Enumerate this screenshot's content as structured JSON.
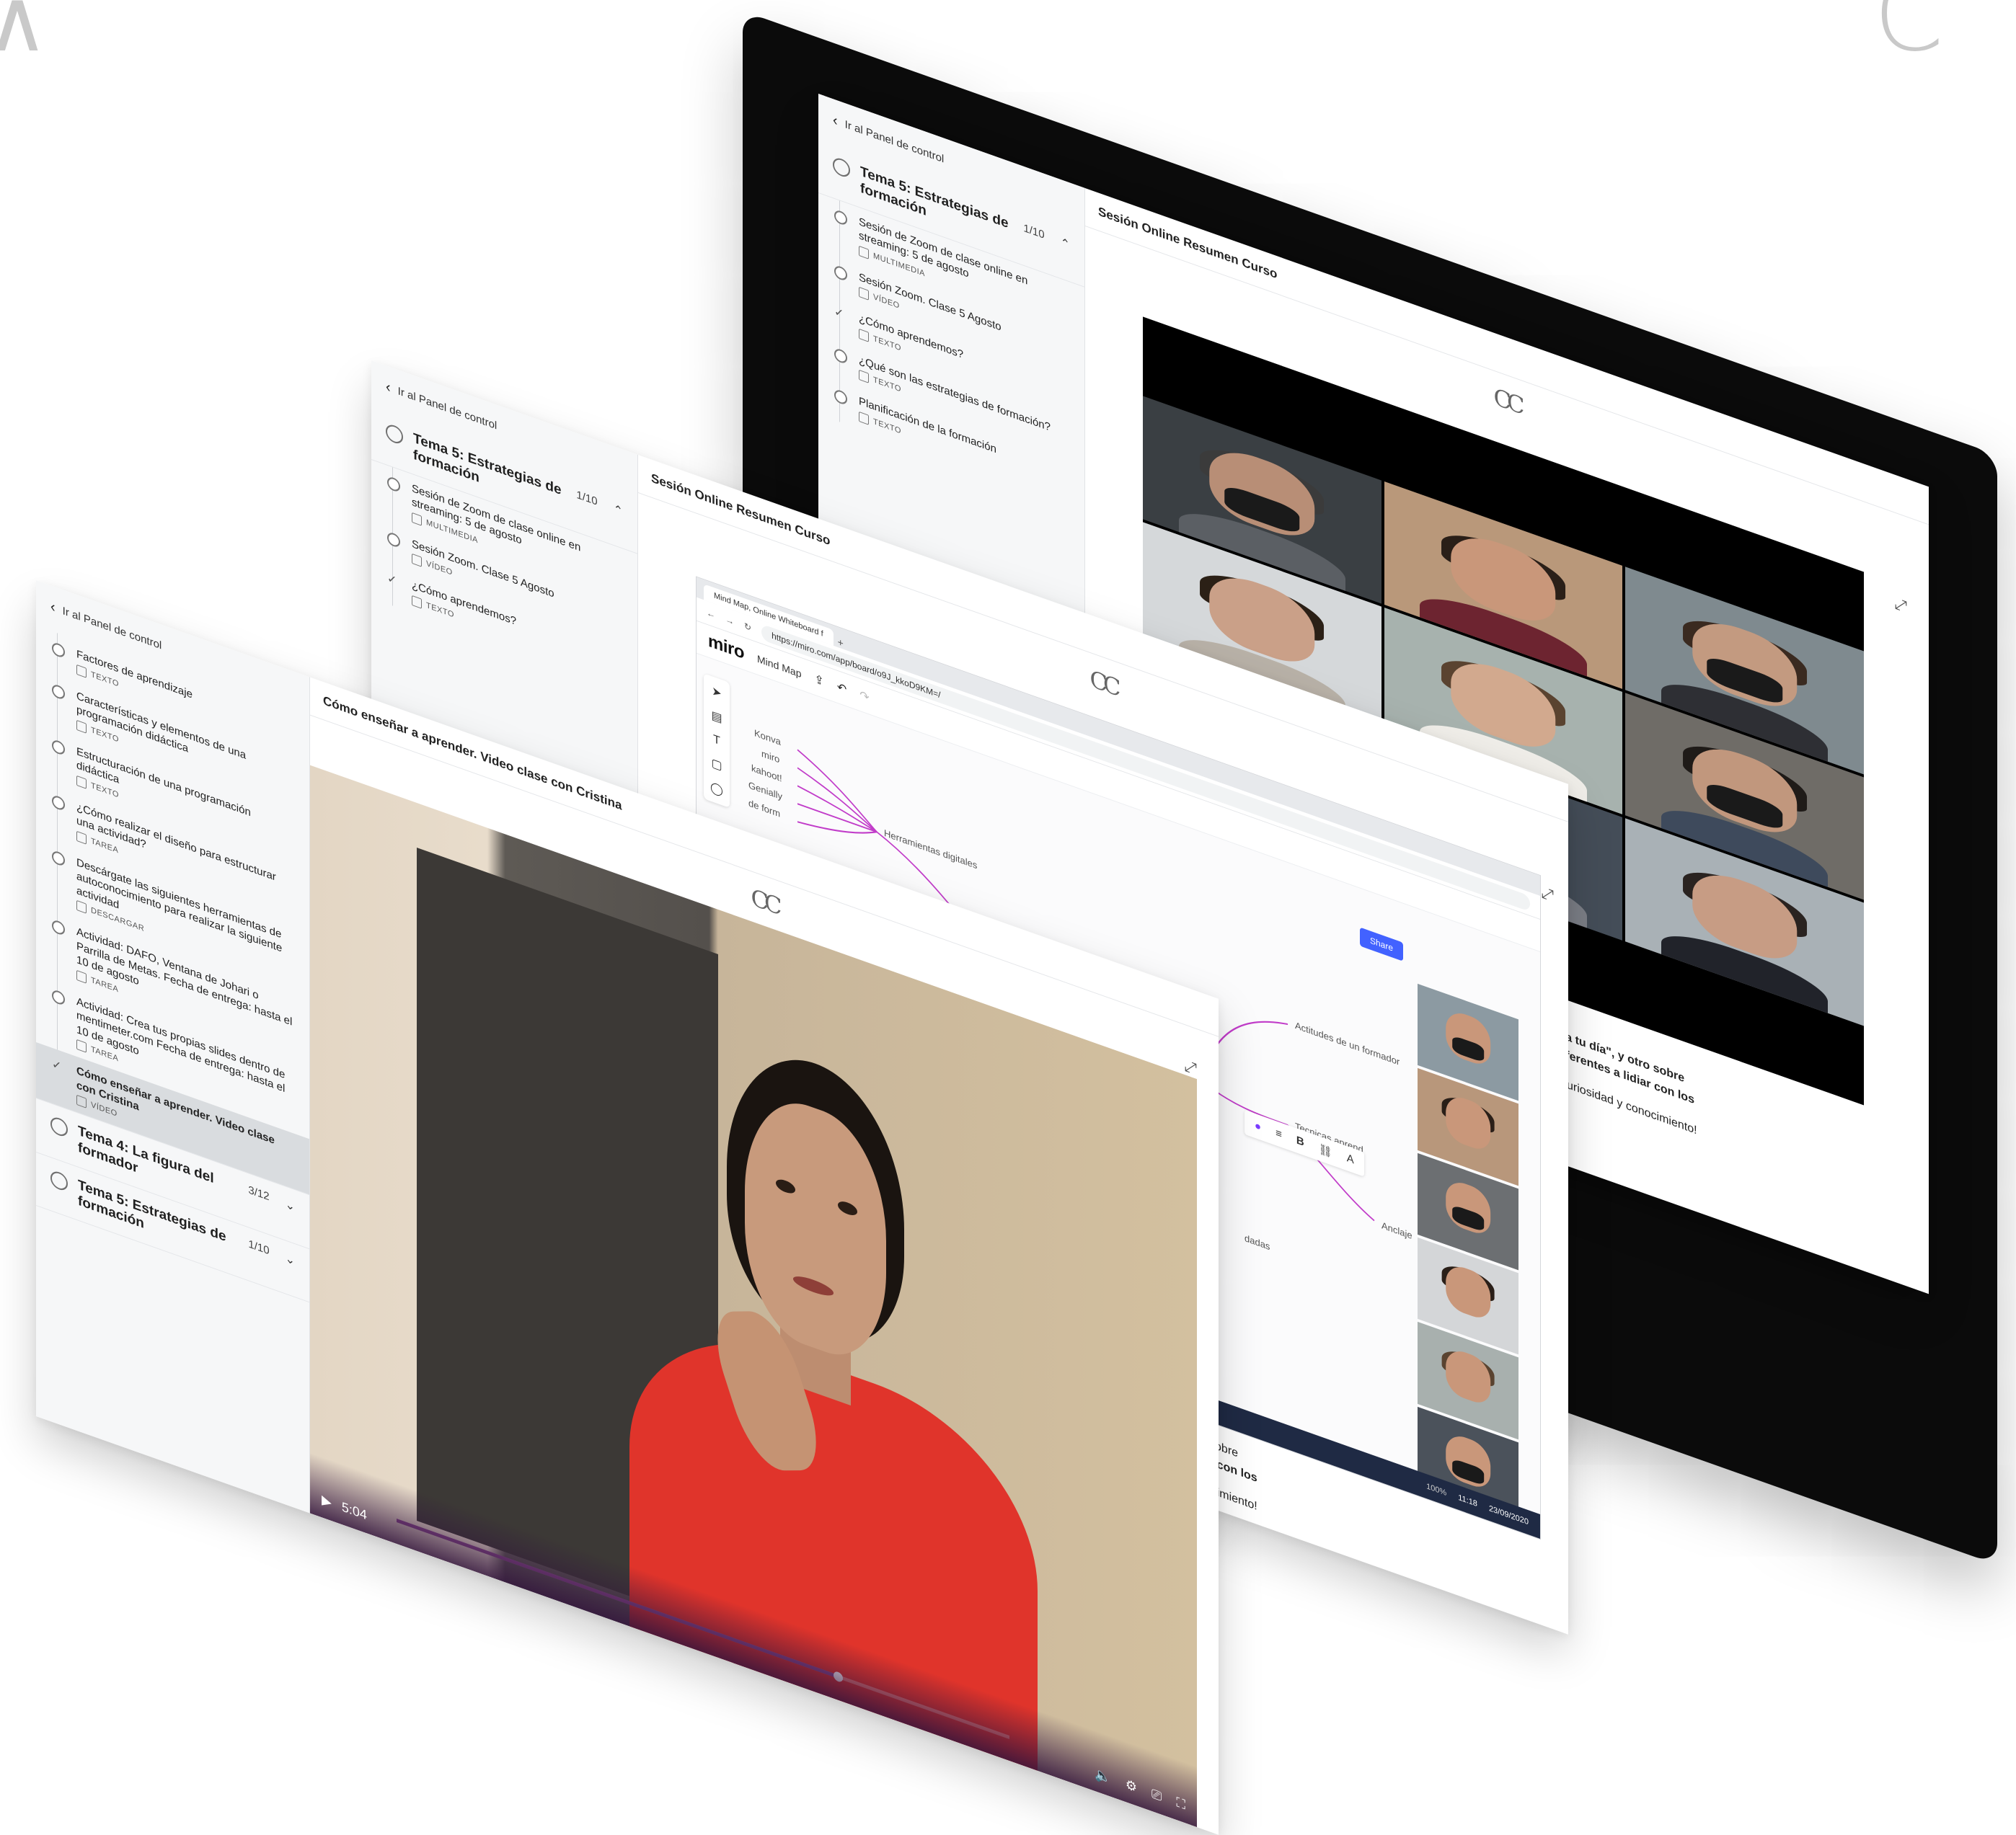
{
  "back_link_label": "Ir al Panel de control",
  "monitor_panel": {
    "topic": {
      "title": "Tema 5: Estrategias de formación",
      "count": "1/10"
    },
    "lessons": [
      {
        "name": "Sesión de Zoom de clase online en streaming: 5 de agosto",
        "type": "MULTIMEDIA"
      },
      {
        "name": "Sesión Zoom. Clase 5 Agosto",
        "type": "VÍDEO"
      },
      {
        "name": "¿Cómo aprendemos?",
        "type": "TEXTO"
      },
      {
        "name": "¿Qué son las estrategias de formación?",
        "type": "TEXTO"
      },
      {
        "name": "Planificación de la formación",
        "type": "TEXTO"
      }
    ],
    "content_title": "Sesión Online Resumen Curso",
    "description_lines": [
      "de 1h a tu día\", y otro sobre",
      "des diferentes a lidiar con los",
      "estra curiosidad y conocimiento!"
    ]
  },
  "mid_panel": {
    "topic": {
      "title": "Tema 5: Estrategias de formación",
      "count": "1/10"
    },
    "lessons": [
      {
        "name": "Sesión de Zoom de clase online en streaming: 5 de agosto",
        "type": "MULTIMEDIA"
      },
      {
        "name": "Sesión Zoom. Clase 5 Agosto",
        "type": "VÍDEO"
      },
      {
        "name": "¿Cómo aprendemos?",
        "type": "TEXTO"
      }
    ],
    "content_title": "Sesión Online Resumen Curso",
    "miro": {
      "tab_label": "Mind Map, Online Whiteboard f",
      "url": "https://miro.com/app/board/o9J_kkoD9KM=/",
      "logo": "miro",
      "board_name": "Mind Map",
      "share_label": "Share",
      "nodes": [
        "Konva",
        "miro",
        "kahoot!",
        "Genially",
        "de form",
        "Herramientas digitales",
        "Actitudes de un formador",
        "Tecnicas aprend",
        "Anclaje",
        "dadas"
      ],
      "zoom_pct": "100%",
      "clock": "11:18",
      "date": "23/09/2020"
    },
    "description_lines": [
      "otro sobre",
      "lidiar con los",
      "conocimiento!"
    ]
  },
  "front_panel": {
    "lessons": [
      {
        "name": "Factores de aprendizaje",
        "type": "TEXTO"
      },
      {
        "name": "Características y elementos de una programación didáctica",
        "type": "TEXTO"
      },
      {
        "name": "Estructuración de una programación didáctica",
        "type": "TEXTO"
      },
      {
        "name": "¿Cómo realizar el diseño para estructurar una actividad?",
        "type": "TAREA"
      },
      {
        "name": "Descárgate las siguientes herramientas de autoconocimiento para realizar la siguiente actividad",
        "type": "DESCARGAR"
      },
      {
        "name": "Actividad: DAFO, Ventana de Johari o Parrilla de Metas. Fecha de entrega: hasta el 10 de agosto",
        "type": "TAREA"
      },
      {
        "name": "Actividad: Crea tus propias slides dentro de mentimeter.com Fecha de entrega: hasta el 10 de agosto",
        "type": "TAREA"
      },
      {
        "name": "Cómo enseñar a aprender. Video clase con Cristina",
        "type": "VÍDEO",
        "active": true
      }
    ],
    "topics": [
      {
        "title": "Tema 4: La figura del formador",
        "count": "3/12"
      },
      {
        "title": "Tema 5: Estrategias de formación",
        "count": "1/10"
      }
    ],
    "content_title": "Cómo enseñar a aprender. Video clase con Cristina",
    "video": {
      "time": "5:04",
      "progress": 0.72
    }
  },
  "icons": {
    "back": "chevron-left-icon",
    "expand": "expand-icon",
    "play": "play-icon",
    "volume": "volume-icon",
    "settings": "gear-icon",
    "cast": "cast-icon",
    "fullscreen": "fullscreen-icon"
  },
  "colors": {
    "accent": "#8b4a8f",
    "miro_share": "#4262ff",
    "mindmap_line": "#c13cc9"
  }
}
